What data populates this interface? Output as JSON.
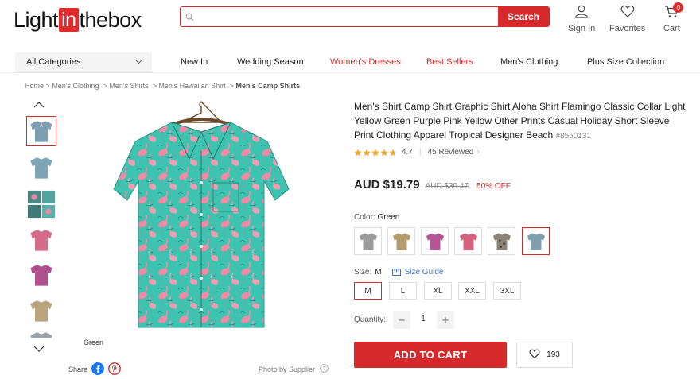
{
  "header": {
    "logo": {
      "pre": "Light",
      "in": "in",
      "post": "thebox"
    },
    "search": {
      "value": "",
      "placeholder": "",
      "button": "Search"
    },
    "signin": {
      "label": "Sign In",
      "icon": "user-icon"
    },
    "favorites": {
      "label": "Favorites",
      "icon": "heart-icon"
    },
    "cart": {
      "label": "Cart",
      "icon": "cart-icon",
      "count": "0"
    }
  },
  "nav": {
    "all_categories": "All Categories",
    "links": [
      {
        "label": "New In",
        "highlight": false
      },
      {
        "label": "Wedding Season",
        "highlight": false
      },
      {
        "label": "Women's Dresses",
        "highlight": true
      },
      {
        "label": "Best Sellers",
        "highlight": true
      },
      {
        "label": "Men's Clothing",
        "highlight": false
      },
      {
        "label": "Plus Size Collection",
        "highlight": false
      }
    ]
  },
  "breadcrumb": {
    "items": [
      "Home",
      "Men's Clothing",
      "Men's Shirts",
      "Men's Hawaiian Shirt"
    ],
    "current": "Men's Camp Shirts",
    "separator": ">"
  },
  "gallery": {
    "caption": "Green",
    "share_label": "Share",
    "supplier_note": "Photo by Supplier",
    "thumbnails": [
      "green",
      "green-back",
      "green-detail",
      "pink",
      "purple",
      "khaki"
    ]
  },
  "product": {
    "title": "Men's Shirt Camp Shirt Graphic Shirt Aloha Shirt Flamingo Classic Collar Light Yellow Green Purple Pink Yellow Other Prints Casual Holiday Short Sleeve Print Clothing Apparel Tropical Designer Beach",
    "sku": "#8550131",
    "rating": 4.7,
    "rating_text": "4.7",
    "reviews": "45 Reviewed",
    "price": "AUD $19.79",
    "old_price": "AUD $39.47",
    "discount": "50% OFF",
    "color_label": "Color:",
    "color_value": "Green",
    "swatches": [
      "gray",
      "khaki",
      "purple",
      "pink",
      "leopard",
      "green"
    ],
    "size_label": "Size:",
    "size_value": "M",
    "size_guide": "Size Guide",
    "sizes": [
      "M",
      "L",
      "XL",
      "XXL",
      "3XL"
    ],
    "quantity_label": "Quantity:",
    "quantity": "1",
    "add_to_cart": "ADD TO CART",
    "wishlist_count": "193"
  },
  "colors": {
    "brand_red": "#d6292b",
    "shirt_base": "#3ec3b0",
    "flamingo": "#f08aa6"
  }
}
